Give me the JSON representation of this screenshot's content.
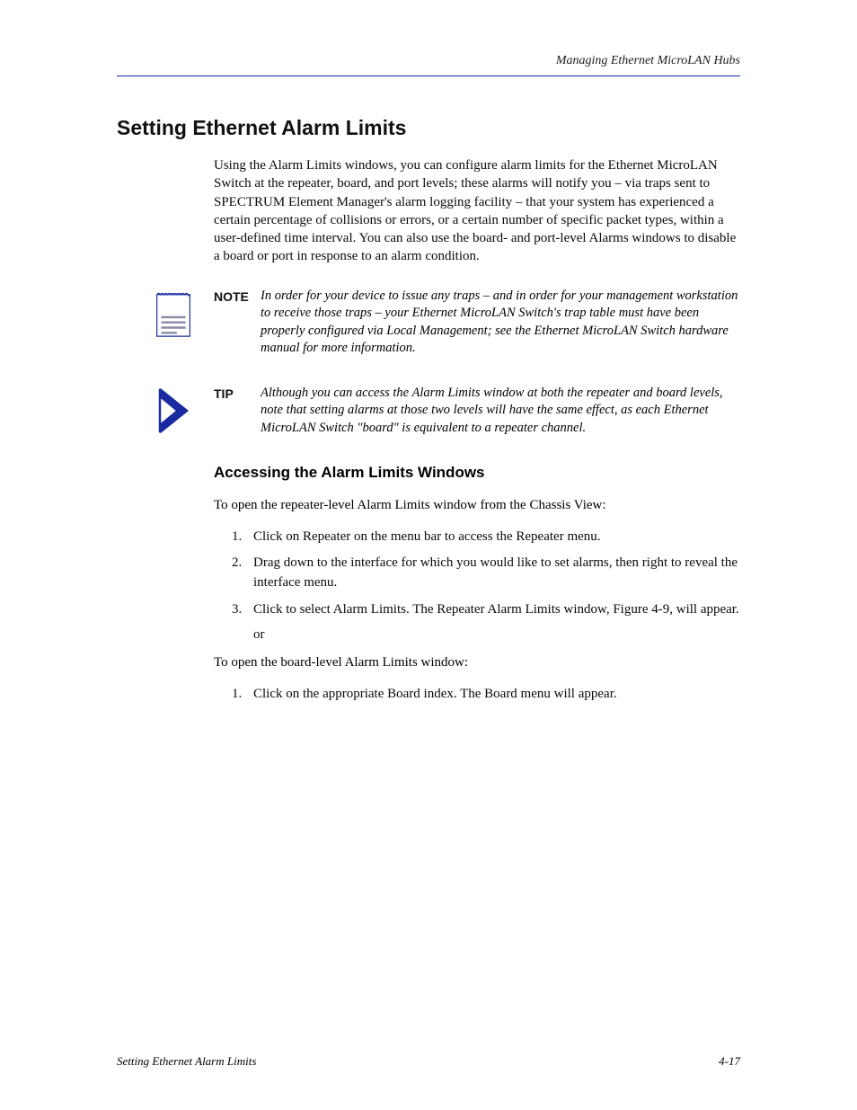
{
  "header": {
    "right": "Managing Ethernet MicroLAN Hubs"
  },
  "section_title": "Setting Ethernet Alarm Limits",
  "body_para1": "Using the Alarm Limits windows, you can configure alarm limits for the Ethernet MicroLAN Switch at the repeater, board, and port levels; these alarms will notify you – via traps sent to SPECTRUM Element Manager's alarm logging facility – that your system has experienced a certain percentage of collisions or errors, or a certain number of specific packet types, within a user-defined time interval. You can also use the board- and port-level Alarms windows to disable a board or port in response to an alarm condition.",
  "note": {
    "label": "NOTE",
    "text": "In order for your device to issue any traps – and in order for your management workstation to receive those traps – your Ethernet MicroLAN Switch's trap table must have been properly configured via Local Management; see the Ethernet MicroLAN Switch hardware manual for more information."
  },
  "tip": {
    "label": "TIP",
    "text": "Although you can access the Alarm Limits window at both the repeater and board levels, note that setting alarms at those two levels will have the same effect, as each Ethernet MicroLAN Switch \"board\" is equivalent to a repeater channel."
  },
  "sub_section_title": "Accessing the Alarm Limits Windows",
  "steps_intro": "To open the repeater-level Alarm Limits window from the Chassis View:",
  "steps": [
    {
      "num": "1.",
      "text": "Click on Repeater on the menu bar to access the Repeater menu."
    },
    {
      "num": "2.",
      "text": "Drag down to the interface for which you would like to set alarms, then right to reveal the interface menu."
    },
    {
      "num": "3.",
      "text": "Click to select Alarm Limits. The Repeater Alarm Limits window, Figure 4-9, will appear."
    }
  ],
  "step_boards": "or",
  "boards_intro": "To open the board-level Alarm Limits window:",
  "board_step1": {
    "num": "1.",
    "text": "Click on the appropriate Board index. The Board menu will appear."
  },
  "footer": {
    "left": "Setting Ethernet Alarm Limits",
    "right": "4-17"
  }
}
